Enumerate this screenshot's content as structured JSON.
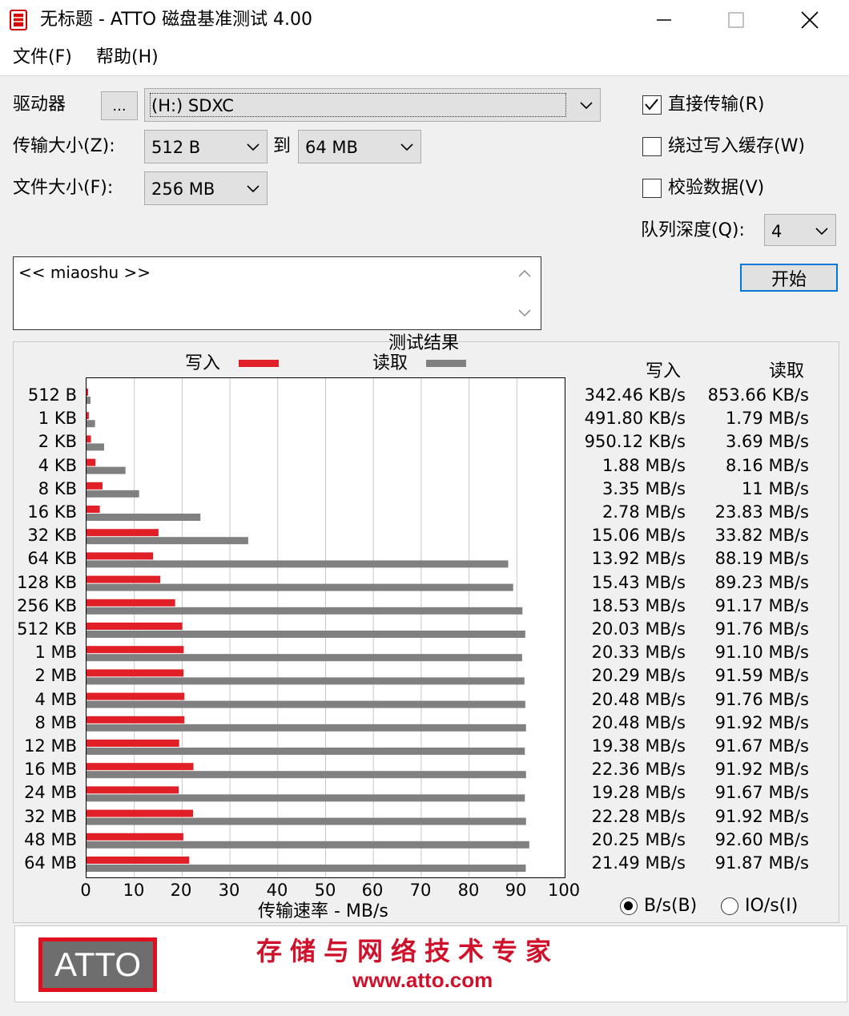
{
  "window": {
    "title": "无标题 - ATTO 磁盘基准测试 4.00"
  },
  "menu": [
    {
      "label": "文件(F)"
    },
    {
      "label": "帮助(H)"
    }
  ],
  "form": {
    "drive_label": "驱动器",
    "browse_label": "...",
    "drive_value": "(H:) SDXC",
    "transfer_size_label": "传输大小(Z):",
    "transfer_from": "512 B",
    "to_label": "到",
    "transfer_to": "64 MB",
    "file_size_label": "文件大小(F):",
    "file_size": "256 MB",
    "direct_io_label": "直接传输(R)",
    "direct_io_checked": true,
    "bypass_cache_label": "绕过写入缓存(W)",
    "bypass_cache_checked": false,
    "verify_label": "校验数据(V)",
    "verify_checked": false,
    "queue_depth_label": "队列深度(Q):",
    "queue_depth": "4",
    "description": "<< miaoshu >>",
    "start_label": "开始"
  },
  "results": {
    "title": "测试结果",
    "write_col_label": "写入",
    "read_col_label": "读取",
    "legend_write": "写入",
    "legend_read": "读取",
    "rows": [
      {
        "size": "512 B",
        "write": "342.46 KB/s",
        "read": "853.66 KB/s"
      },
      {
        "size": "1 KB",
        "write": "491.80 KB/s",
        "read": "1.79 MB/s"
      },
      {
        "size": "2 KB",
        "write": "950.12 KB/s",
        "read": "3.69 MB/s"
      },
      {
        "size": "4 KB",
        "write": "1.88 MB/s",
        "read": "8.16 MB/s"
      },
      {
        "size": "8 KB",
        "write": "3.35 MB/s",
        "read": "11 MB/s"
      },
      {
        "size": "16 KB",
        "write": "2.78 MB/s",
        "read": "23.83 MB/s"
      },
      {
        "size": "32 KB",
        "write": "15.06 MB/s",
        "read": "33.82 MB/s"
      },
      {
        "size": "64 KB",
        "write": "13.92 MB/s",
        "read": "88.19 MB/s"
      },
      {
        "size": "128 KB",
        "write": "15.43 MB/s",
        "read": "89.23 MB/s"
      },
      {
        "size": "256 KB",
        "write": "18.53 MB/s",
        "read": "91.17 MB/s"
      },
      {
        "size": "512 KB",
        "write": "20.03 MB/s",
        "read": "91.76 MB/s"
      },
      {
        "size": "1 MB",
        "write": "20.33 MB/s",
        "read": "91.10 MB/s"
      },
      {
        "size": "2 MB",
        "write": "20.29 MB/s",
        "read": "91.59 MB/s"
      },
      {
        "size": "4 MB",
        "write": "20.48 MB/s",
        "read": "91.76 MB/s"
      },
      {
        "size": "8 MB",
        "write": "20.48 MB/s",
        "read": "91.92 MB/s"
      },
      {
        "size": "12 MB",
        "write": "19.38 MB/s",
        "read": "91.67 MB/s"
      },
      {
        "size": "16 MB",
        "write": "22.36 MB/s",
        "read": "91.92 MB/s"
      },
      {
        "size": "24 MB",
        "write": "19.28 MB/s",
        "read": "91.67 MB/s"
      },
      {
        "size": "32 MB",
        "write": "22.28 MB/s",
        "read": "91.92 MB/s"
      },
      {
        "size": "48 MB",
        "write": "20.25 MB/s",
        "read": "92.60 MB/s"
      },
      {
        "size": "64 MB",
        "write": "21.49 MB/s",
        "read": "91.87 MB/s"
      }
    ],
    "unit_bytes_label": "B/s(B)",
    "unit_bytes_selected": true,
    "unit_io_label": "IO/s(I)",
    "unit_io_selected": false
  },
  "chart_data": {
    "type": "bar",
    "orientation": "horizontal",
    "xlabel": "传输速率 - MB/s",
    "xlim": [
      0,
      100
    ],
    "xticks": [
      "0",
      "10",
      "20",
      "30",
      "40",
      "50",
      "60",
      "70",
      "80",
      "90",
      "100"
    ],
    "grid": true,
    "legend_position": "top",
    "categories": [
      "512 B",
      "1 KB",
      "2 KB",
      "4 KB",
      "8 KB",
      "16 KB",
      "32 KB",
      "64 KB",
      "128 KB",
      "256 KB",
      "512 KB",
      "1 MB",
      "2 MB",
      "4 MB",
      "8 MB",
      "12 MB",
      "16 MB",
      "24 MB",
      "32 MB",
      "48 MB",
      "64 MB"
    ],
    "series": [
      {
        "name": "写入",
        "color": "#e01f26",
        "values": [
          0.33,
          0.48,
          0.93,
          1.88,
          3.35,
          2.78,
          15.06,
          13.92,
          15.43,
          18.53,
          20.03,
          20.33,
          20.29,
          20.48,
          20.48,
          19.38,
          22.36,
          19.28,
          22.28,
          20.25,
          21.49
        ]
      },
      {
        "name": "读取",
        "color": "#808080",
        "values": [
          0.83,
          1.79,
          3.69,
          8.16,
          11,
          23.83,
          33.82,
          88.19,
          89.23,
          91.17,
          91.76,
          91.1,
          91.59,
          91.76,
          91.92,
          91.67,
          91.92,
          91.67,
          91.92,
          92.6,
          91.87
        ]
      }
    ]
  },
  "banner": {
    "logo_text": "ATTO",
    "slogan": "存储与网络技术专家",
    "url": "www.atto.com"
  }
}
